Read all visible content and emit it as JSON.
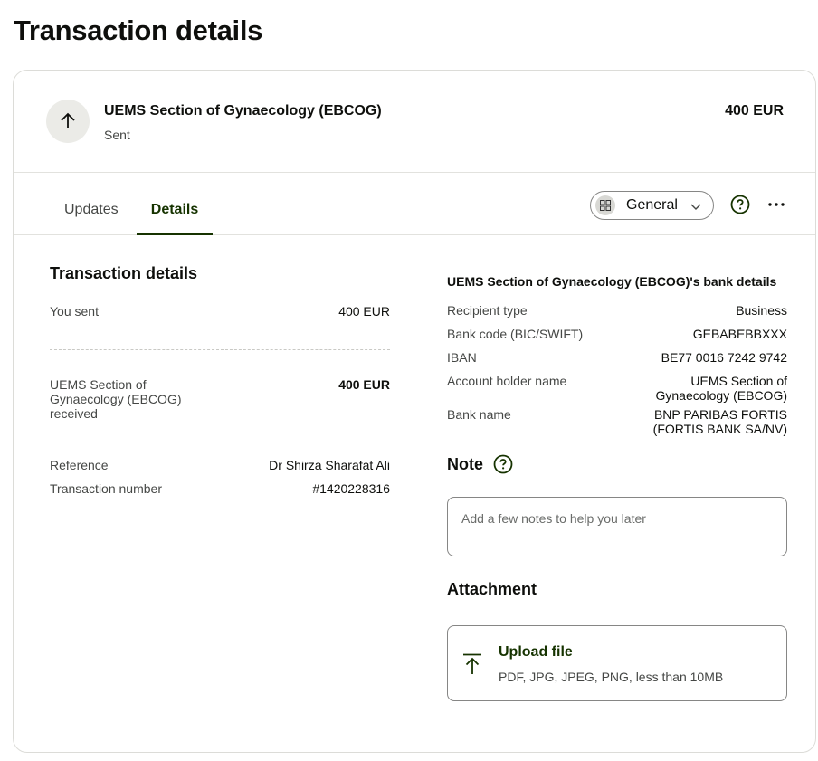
{
  "page": {
    "title": "Transaction details"
  },
  "transaction": {
    "recipient": "UEMS Section of Gynaecology (EBCOG)",
    "status": "Sent",
    "amount": "400 EUR",
    "icon": "arrow-up-icon"
  },
  "tabs": [
    {
      "label": "Updates",
      "active": false
    },
    {
      "label": "Details",
      "active": true
    }
  ],
  "view_select": {
    "label": "General",
    "icon": "grid-icon"
  },
  "colors": {
    "accent": "#163300",
    "border": "#868685",
    "muted": "#454745"
  },
  "details": {
    "title": "Transaction details",
    "you_sent": {
      "label": "You sent",
      "value": "400 EUR"
    },
    "received": {
      "label": "UEMS Section of Gynaecology (EBCOG) received",
      "value": "400 EUR"
    },
    "reference": {
      "label": "Reference",
      "value": "Dr Shirza Sharafat Ali"
    },
    "transaction_number": {
      "label": "Transaction number",
      "value": "#1420228316"
    }
  },
  "bank": {
    "title": "UEMS Section of Gynaecology (EBCOG)'s bank details",
    "rows": [
      {
        "label": "Recipient type",
        "value": "Business"
      },
      {
        "label": "Bank code (BIC/SWIFT)",
        "value": "GEBABEBBXXX"
      },
      {
        "label": "IBAN",
        "value": "BE77 0016 7242 9742"
      },
      {
        "label": "Account holder name",
        "value": "UEMS Section of Gynaecology (EBCOG)"
      },
      {
        "label": "Bank name",
        "value": "BNP PARIBAS FORTIS (FORTIS BANK SA/NV)"
      }
    ]
  },
  "note": {
    "title": "Note",
    "placeholder": "Add a few notes to help you later"
  },
  "attachment": {
    "title": "Attachment",
    "upload_label": "Upload file",
    "hint": "PDF, JPG, JPEG, PNG, less than 10MB"
  }
}
